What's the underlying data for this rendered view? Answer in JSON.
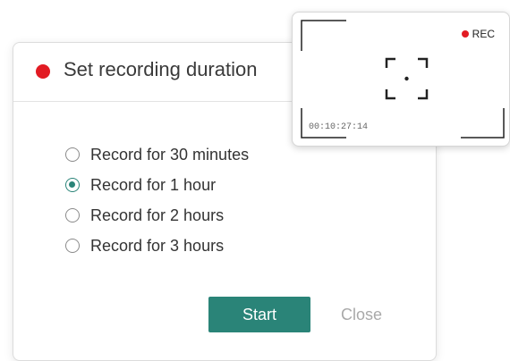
{
  "dialog": {
    "title": "Set recording duration",
    "options": [
      {
        "label": "Record for 30 minutes",
        "selected": false
      },
      {
        "label": "Record for 1 hour",
        "selected": true
      },
      {
        "label": "Record for 2 hours",
        "selected": false
      },
      {
        "label": "Record for 3 hours",
        "selected": false
      }
    ],
    "start_label": "Start",
    "close_label": "Close"
  },
  "preview": {
    "rec_label": "REC",
    "timecode": "00:10:27:14"
  },
  "colors": {
    "accent": "#2a8478",
    "record_red": "#e21b23",
    "disabled_text": "#a9a9a9"
  }
}
